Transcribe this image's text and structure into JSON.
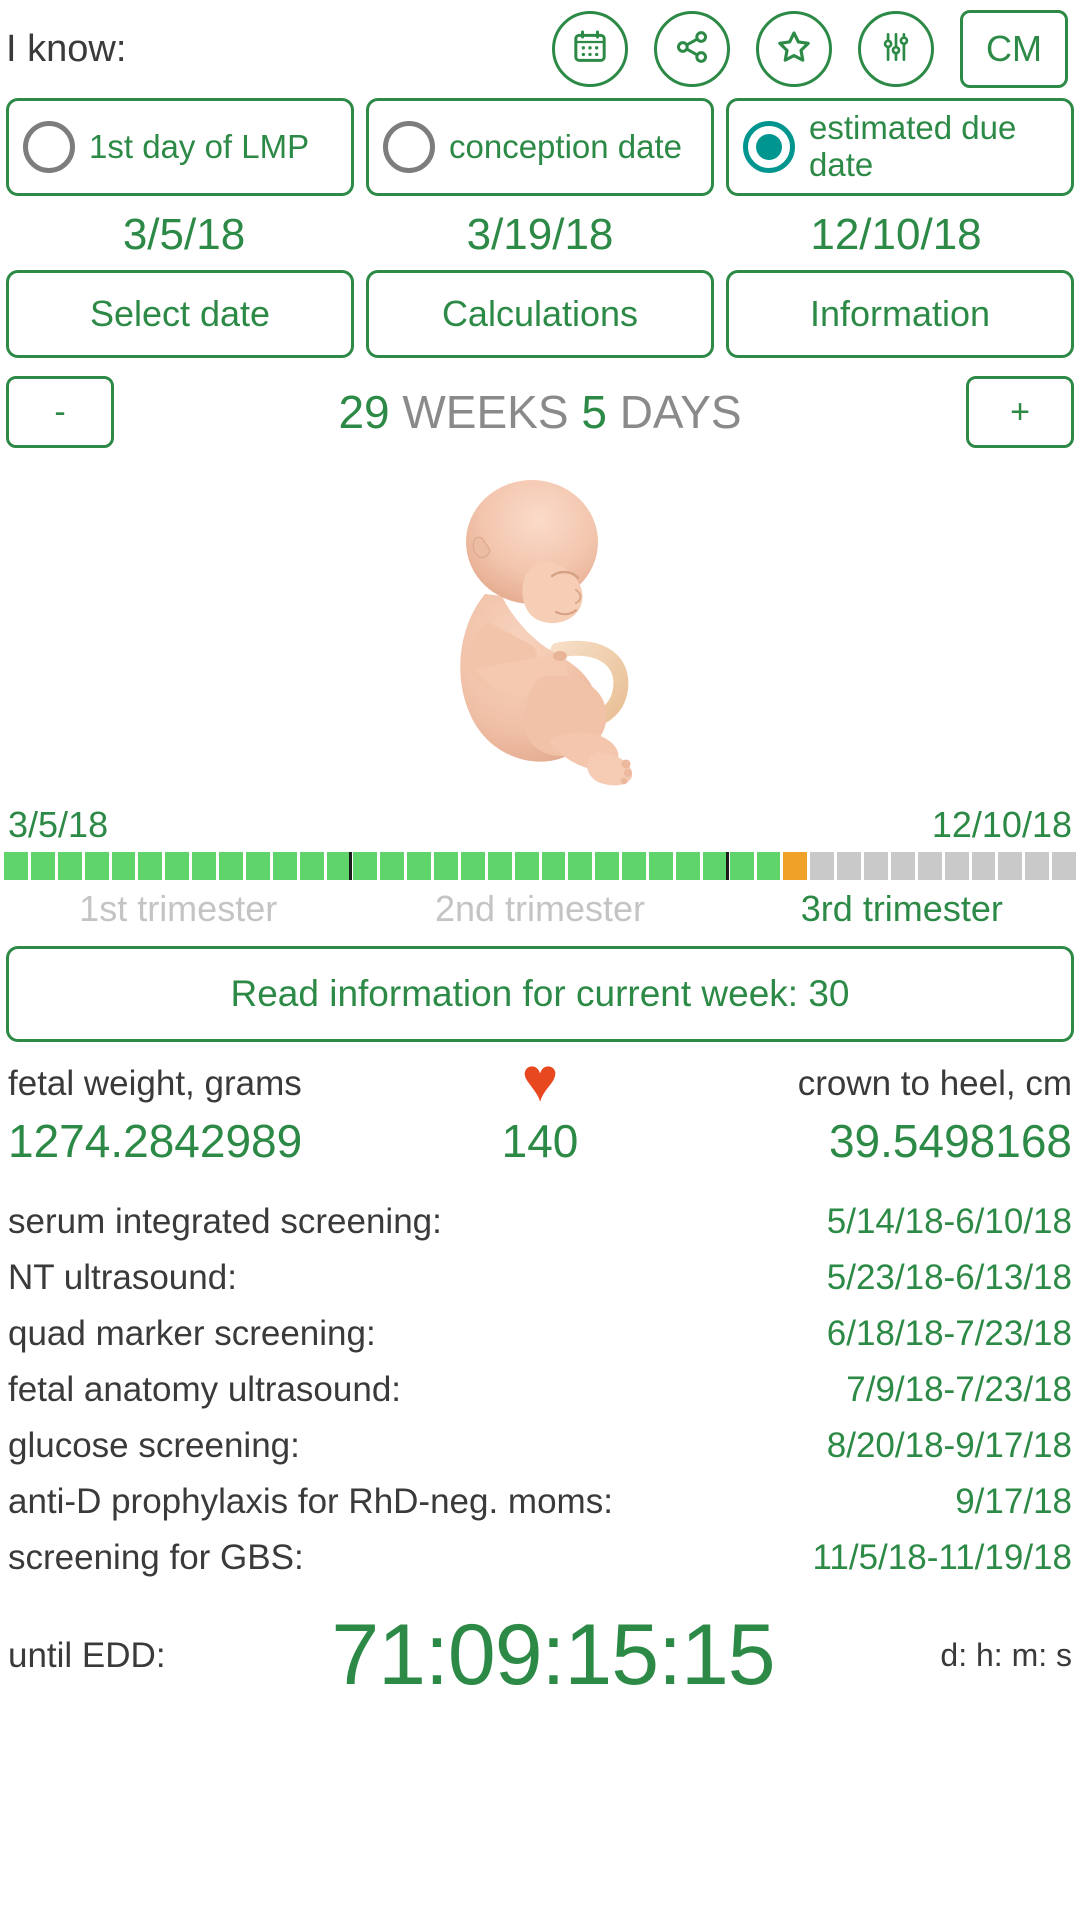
{
  "header": {
    "i_know_label": "I know:",
    "icons": [
      {
        "name": "calendar-icon",
        "label": "calendar"
      },
      {
        "name": "share-icon",
        "label": "share"
      },
      {
        "name": "star-icon",
        "label": "favorite"
      },
      {
        "name": "sliders-icon",
        "label": "settings"
      }
    ],
    "units_button": "CM"
  },
  "input_modes": [
    {
      "label": "1st day of LMP",
      "selected": false,
      "date": "3/5/18"
    },
    {
      "label": "conception date",
      "selected": false,
      "date": "3/19/18"
    },
    {
      "label": "estimated due date",
      "selected": true,
      "date": "12/10/18"
    }
  ],
  "actions": [
    {
      "label": "Select date"
    },
    {
      "label": "Calculations"
    },
    {
      "label": "Information"
    }
  ],
  "gestation": {
    "minus_label": "-",
    "plus_label": "+",
    "weeks_value": "29",
    "weeks_unit": "WEEKS",
    "days_value": "5",
    "days_unit": "DAYS"
  },
  "progress": {
    "start_date": "3/5/18",
    "end_date": "12/10/18",
    "total_segments": 40,
    "completed_segments": 29,
    "current_segment": 30,
    "trimester_marks": [
      13,
      27
    ],
    "trimesters": [
      {
        "label": "1st trimester",
        "active": false,
        "weight": 13
      },
      {
        "label": "2nd trimester",
        "active": false,
        "weight": 14
      },
      {
        "label": "3rd trimester",
        "active": true,
        "weight": 13
      }
    ]
  },
  "read_info_button": "Read information for current week: 30",
  "stats": {
    "weight_label": "fetal weight, grams",
    "weight_value": "1274.2842989",
    "heart_icon": "♥",
    "heart_value": "140",
    "length_label": "crown to heel, cm",
    "length_value": "39.5498168"
  },
  "schedule": [
    {
      "label": "serum integrated screening:",
      "value": "5/14/18-6/10/18"
    },
    {
      "label": "NT ultrasound:",
      "value": "5/23/18-6/13/18"
    },
    {
      "label": "quad marker screening:",
      "value": "6/18/18-7/23/18"
    },
    {
      "label": "fetal anatomy ultrasound:",
      "value": "7/9/18-7/23/18"
    },
    {
      "label": "glucose screening:",
      "value": "8/20/18-9/17/18"
    },
    {
      "label": "anti-D prophylaxis for RhD-neg. moms:",
      "value": "9/17/18"
    },
    {
      "label": "screening for GBS:",
      "value": "11/5/18-11/19/18"
    }
  ],
  "countdown": {
    "label": "until EDD:",
    "value": "71:09:15:15",
    "units": "d: h: m: s"
  },
  "colors": {
    "green": "#2c8a46",
    "teal": "#00968f",
    "progress_done": "#5ed46a",
    "progress_current": "#f0a128",
    "progress_todo": "#c9c9c9",
    "heart_red": "#e8481f",
    "muted": "#8a8a8a"
  }
}
